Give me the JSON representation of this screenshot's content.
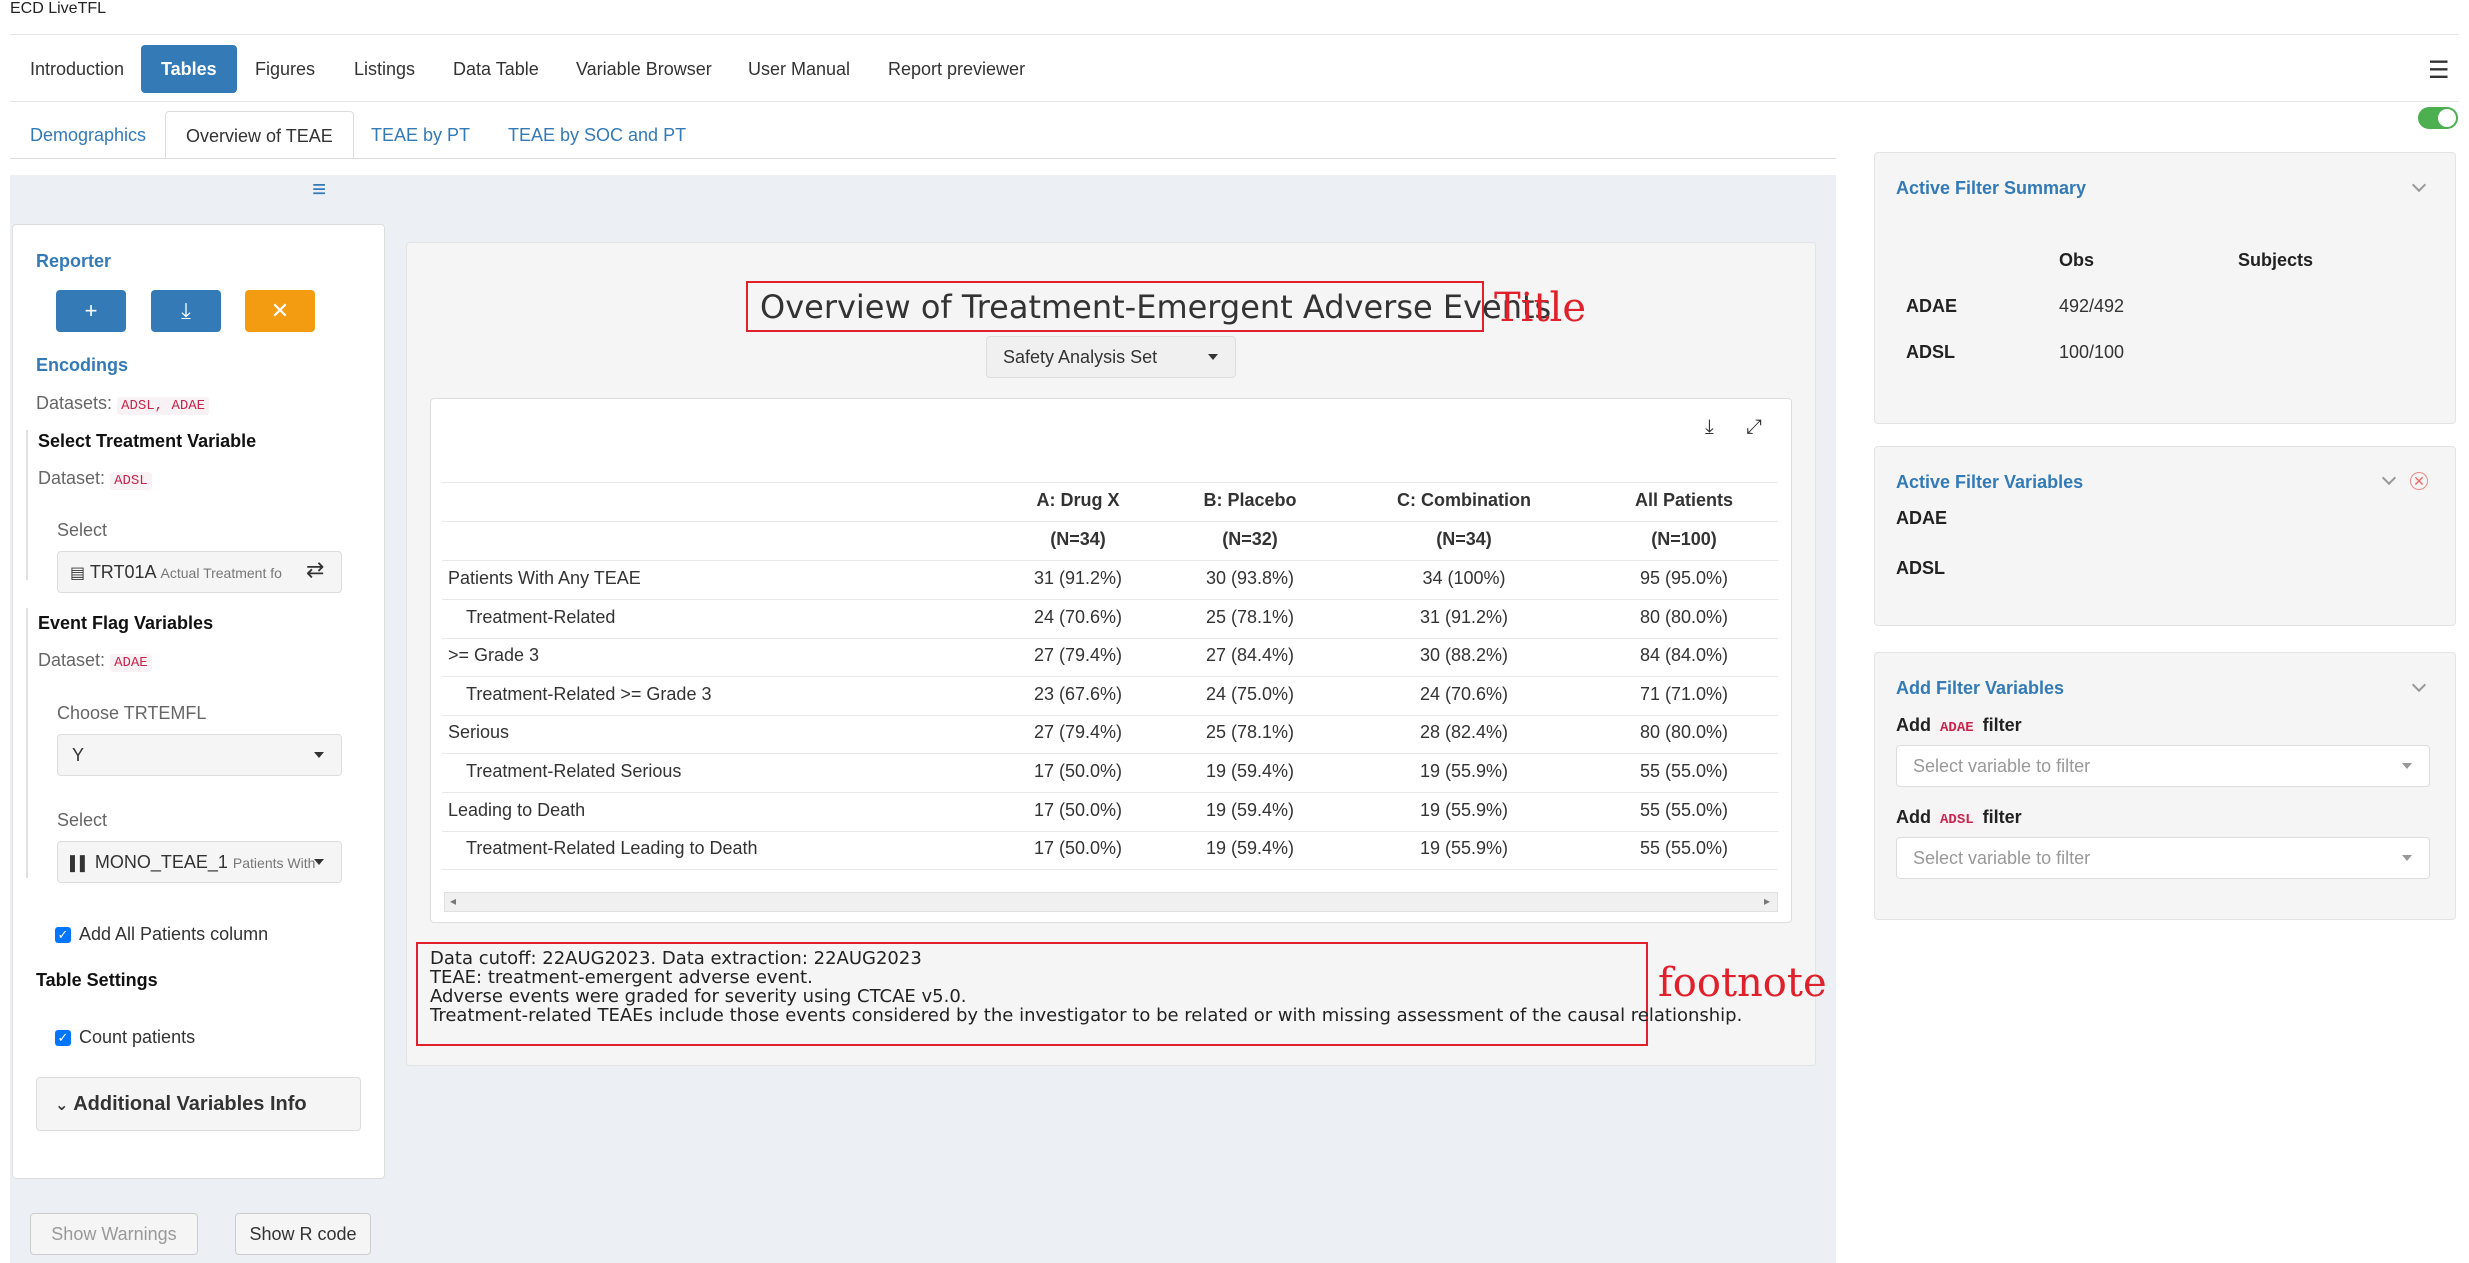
{
  "app_title": "ECD LiveTFL",
  "nav": {
    "items": [
      "Introduction",
      "Tables",
      "Figures",
      "Listings",
      "Data Table",
      "Variable Browser",
      "User Manual",
      "Report previewer"
    ],
    "active": "Tables"
  },
  "subtabs": {
    "items": [
      "Demographics",
      "Overview of TEAE",
      "TEAE by PT",
      "TEAE by SOC and PT"
    ],
    "active": "Overview of TEAE"
  },
  "left_panel": {
    "reporter_label": "Reporter",
    "buttons": {
      "add": "+",
      "download": "⤓",
      "close": "✕"
    },
    "encodings_label": "Encodings",
    "datasets_label": "Datasets:",
    "datasets_value": "ADSL, ADAE",
    "select_treatment_heading": "Select Treatment Variable",
    "dataset_label": "Dataset:",
    "treatment_dataset": "ADSL",
    "select_label": "Select",
    "treatment_var": "TRT01A",
    "treatment_var_desc": "Actual Treatment fo",
    "event_flag_heading": "Event Flag Variables",
    "event_dataset": "ADAE",
    "choose_label": "Choose TRTEMFL",
    "choose_value": "Y",
    "select_label_2": "Select",
    "event_var": "MONO_TEAE_1",
    "event_var_desc": "Patients With",
    "add_all_patients": "Add All Patients column",
    "table_settings": "Table Settings",
    "count_patients": "Count patients",
    "additional_info": "Additional Variables Info",
    "show_warnings": "Show Warnings",
    "show_r_code": "Show R code"
  },
  "report": {
    "title": "Overview of Treatment-Emergent Adverse Events",
    "title_annotation": "Title",
    "population": "Safety Analysis Set",
    "columns": [
      "A: Drug X",
      "B: Placebo",
      "C: Combination",
      "All Patients"
    ],
    "column_ns": [
      "(N=34)",
      "(N=32)",
      "(N=34)",
      "(N=100)"
    ],
    "rows": [
      {
        "label": "Patients With Any TEAE",
        "indent": false,
        "values": [
          "31 (91.2%)",
          "30 (93.8%)",
          "34 (100%)",
          "95 (95.0%)"
        ]
      },
      {
        "label": "Treatment-Related",
        "indent": true,
        "values": [
          "24 (70.6%)",
          "25 (78.1%)",
          "31 (91.2%)",
          "80 (80.0%)"
        ]
      },
      {
        "label": ">= Grade 3",
        "indent": false,
        "values": [
          "27 (79.4%)",
          "27 (84.4%)",
          "30 (88.2%)",
          "84 (84.0%)"
        ]
      },
      {
        "label": "Treatment-Related >= Grade 3",
        "indent": true,
        "values": [
          "23 (67.6%)",
          "24 (75.0%)",
          "24 (70.6%)",
          "71 (71.0%)"
        ]
      },
      {
        "label": "Serious",
        "indent": false,
        "values": [
          "27 (79.4%)",
          "25 (78.1%)",
          "28 (82.4%)",
          "80 (80.0%)"
        ]
      },
      {
        "label": "Treatment-Related Serious",
        "indent": true,
        "values": [
          "17 (50.0%)",
          "19 (59.4%)",
          "19 (55.9%)",
          "55 (55.0%)"
        ]
      },
      {
        "label": "Leading to Death",
        "indent": false,
        "values": [
          "17 (50.0%)",
          "19 (59.4%)",
          "19 (55.9%)",
          "55 (55.0%)"
        ]
      },
      {
        "label": "Treatment-Related Leading to Death",
        "indent": true,
        "values": [
          "17 (50.0%)",
          "19 (59.4%)",
          "19 (55.9%)",
          "55 (55.0%)"
        ]
      }
    ],
    "footnotes": [
      "Data cutoff: 22AUG2023. Data extraction: 22AUG2023",
      "TEAE: treatment-emergent adverse event.",
      "Adverse events were graded for severity using CTCAE v5.0.",
      "Treatment-related TEAEs include those events considered by the investigator to be related or with missing assessment of the causal relationship."
    ],
    "footnote_annotation": "footnote"
  },
  "filter_summary": {
    "title": "Active Filter Summary",
    "col_obs": "Obs",
    "col_subjects": "Subjects",
    "rows": [
      {
        "name": "ADAE",
        "obs": "492/492",
        "subjects": ""
      },
      {
        "name": "ADSL",
        "obs": "100/100",
        "subjects": ""
      }
    ]
  },
  "filter_variables": {
    "title": "Active Filter Variables",
    "datasets": [
      "ADAE",
      "ADSL"
    ]
  },
  "add_filter": {
    "title": "Add Filter Variables",
    "add_label": "Add",
    "filter_label": "filter",
    "entries": [
      {
        "dataset": "ADAE",
        "placeholder": "Select variable to filter"
      },
      {
        "dataset": "ADSL",
        "placeholder": "Select variable to filter"
      }
    ]
  }
}
